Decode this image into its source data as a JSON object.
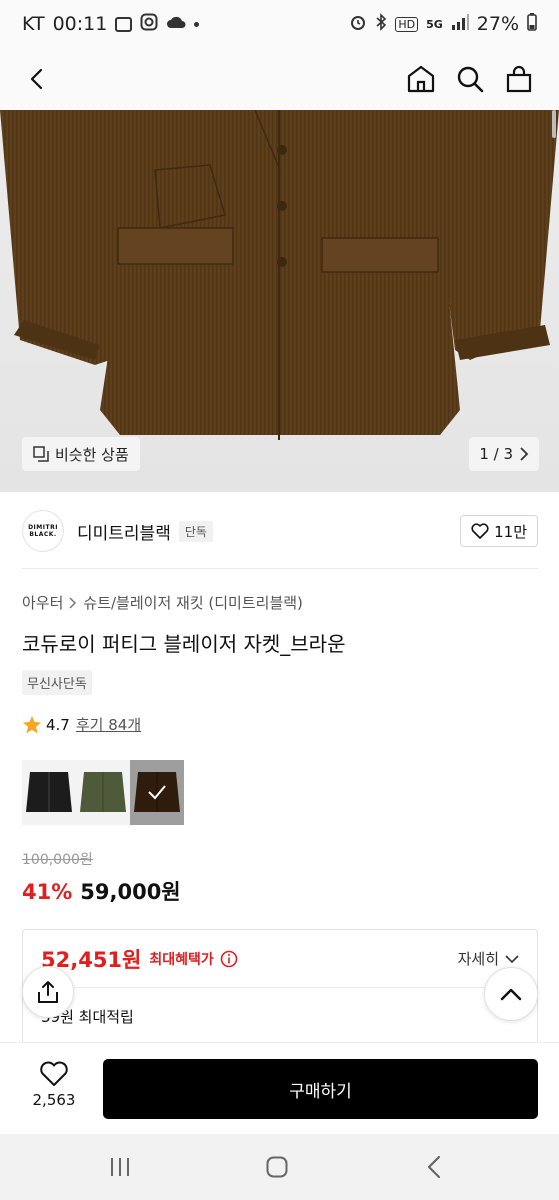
{
  "status_bar": {
    "carrier": "KT",
    "time": "00:11",
    "battery": "27%",
    "network_label": "5G",
    "hd_label": "HD"
  },
  "header": {
    "back_icon": "chevron-left-icon",
    "home_icon": "home-icon",
    "search_icon": "search-icon",
    "cart_icon": "shopping-bag-icon"
  },
  "gallery": {
    "similar_label": "비슷한 상품",
    "page_indicator": "1 / 3"
  },
  "brand": {
    "logo_line1": "DIMITRI",
    "logo_line2": "BLACK.",
    "name": "디미트리블랙",
    "tag": "단독",
    "likes": "11만"
  },
  "product": {
    "breadcrumb": [
      "아우터",
      "슈트/블레이저 재킷 (디미트리블랙)"
    ],
    "title": "코듀로이 퍼티그 블레이저 자켓_브라운",
    "exclusive_tag": "무신사단독",
    "rating": "4.7",
    "reviews": "후기 84개",
    "swatches": [
      "black",
      "khaki",
      "brown"
    ],
    "original_price": "100,000원",
    "discount": "41%",
    "sale_price": "59,000원"
  },
  "benefit": {
    "max_price": "52,451원",
    "max_label": "최대혜택가",
    "detail_label": "자세히",
    "points": "39원 최대적립"
  },
  "bottom_bar": {
    "like_count": "2,563",
    "buy_label": "구매하기"
  },
  "colors": {
    "accent_red": "#e21f1f",
    "jacket_brown": "#5e3f1c",
    "buy_button": "#000000"
  }
}
